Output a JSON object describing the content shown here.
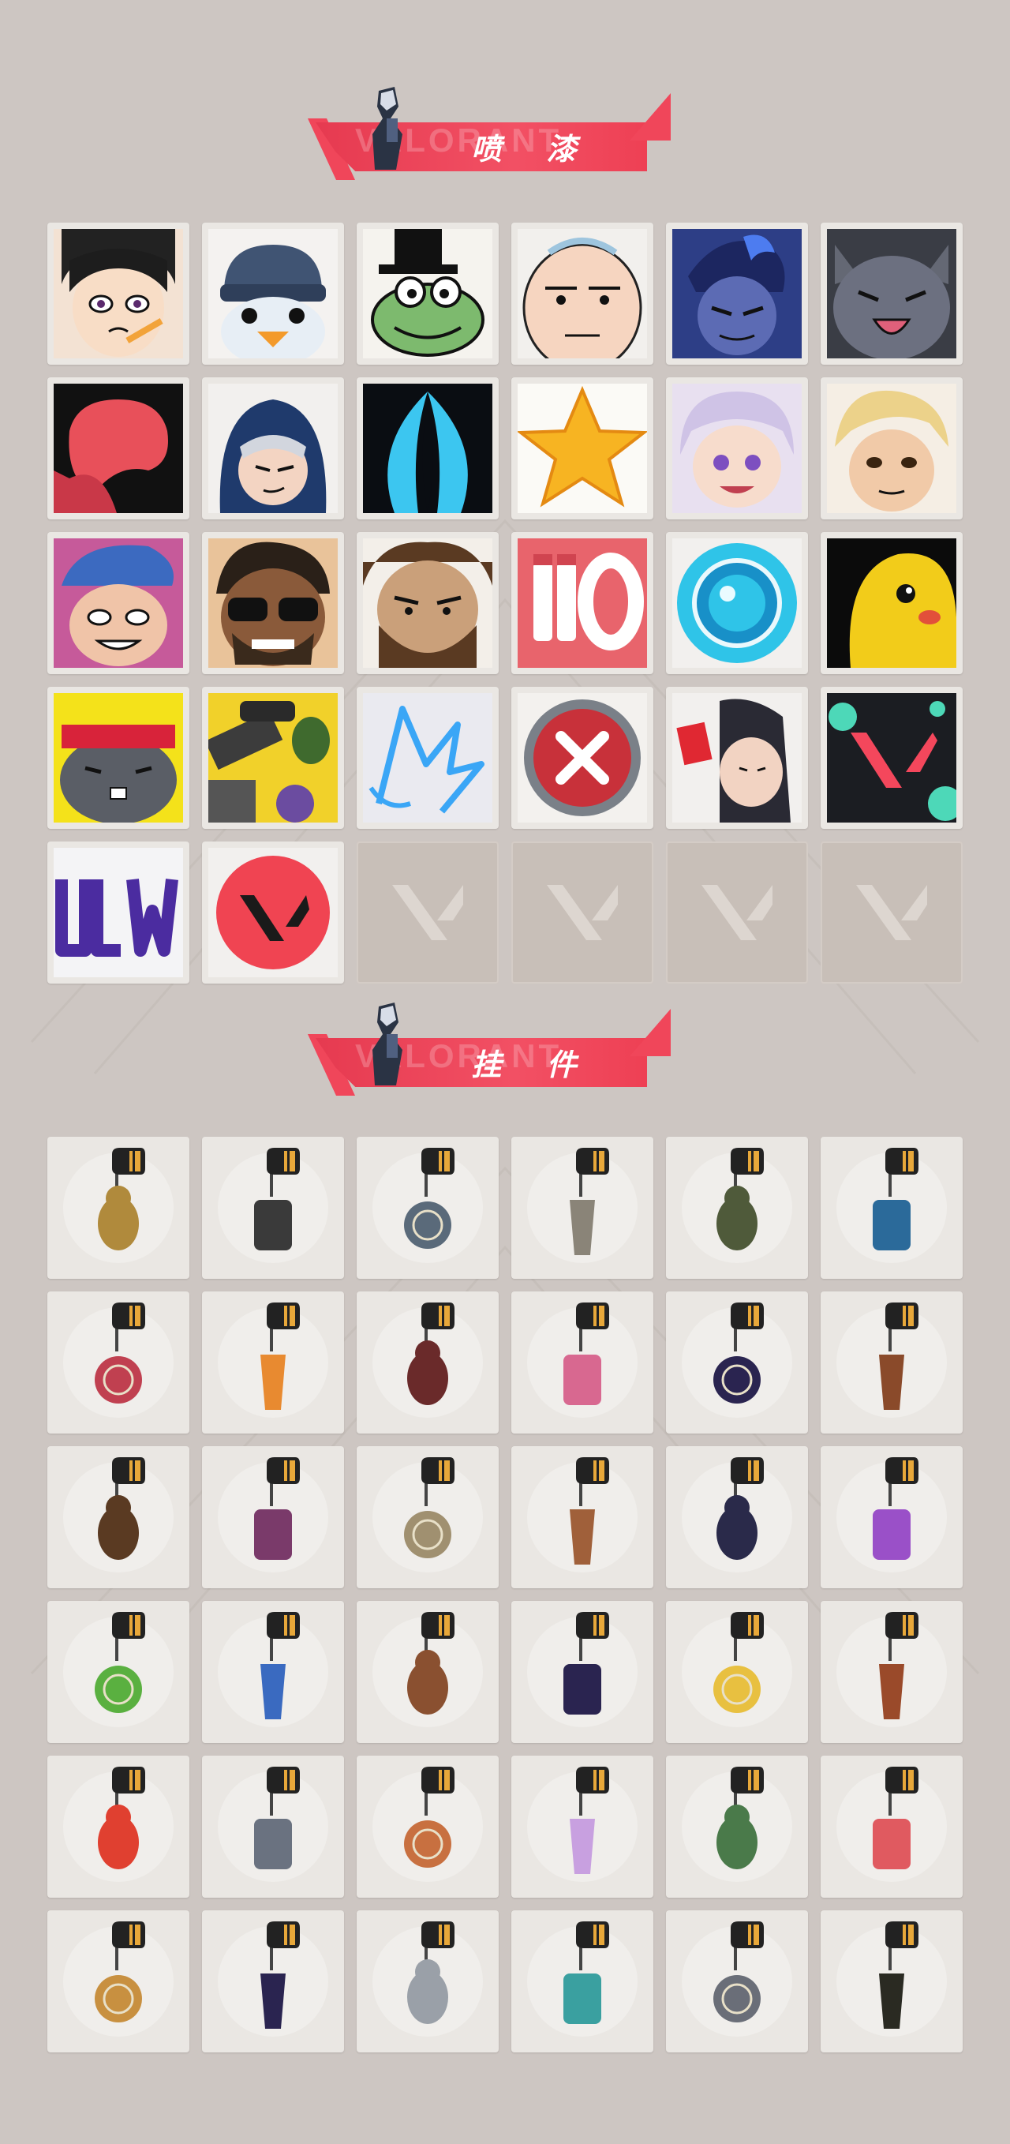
{
  "sections": [
    {
      "title": "喷 漆",
      "ghost_text": "VALORANT"
    },
    {
      "title": "挂 件",
      "ghost_text": "VALORANT"
    }
  ],
  "colors": {
    "accent": "#f0465a",
    "background": "#cdc6c2",
    "tile": "#eae7e3"
  },
  "sprays": [
    {
      "name": "spray-girl-pencil-icon"
    },
    {
      "name": "spray-penguin-beanie-icon"
    },
    {
      "name": "spray-frog-hat-icon"
    },
    {
      "name": "spray-bald-face-icon"
    },
    {
      "name": "spray-blue-agent-icon"
    },
    {
      "name": "spray-gray-cat-icon"
    },
    {
      "name": "spray-red-blob-icon"
    },
    {
      "name": "spray-hooded-agent-icon"
    },
    {
      "name": "spray-blue-flame-icon"
    },
    {
      "name": "spray-star-icon"
    },
    {
      "name": "spray-white-hair-girl-icon"
    },
    {
      "name": "spray-blond-agent-icon"
    },
    {
      "name": "spray-blue-cap-agent-icon"
    },
    {
      "name": "spray-sunglasses-agent-icon"
    },
    {
      "name": "spray-bearded-agent-icon"
    },
    {
      "name": "spray-ammo-counter-icon"
    },
    {
      "name": "spray-blue-orb-icon"
    },
    {
      "name": "spray-yellow-creature-icon"
    },
    {
      "name": "spray-bandana-cat-icon"
    },
    {
      "name": "spray-weapon-collage-icon"
    },
    {
      "name": "spray-neon-crown-icon"
    },
    {
      "name": "spray-red-x-button-icon"
    },
    {
      "name": "spray-red-card-agent-icon"
    },
    {
      "name": "spray-valorant-splash-icon"
    },
    {
      "name": "spray-purple-graffiti-icon"
    },
    {
      "name": "spray-valorant-red-circle-icon"
    }
  ],
  "empty_slots": 4,
  "buddies": [
    {
      "name": "buddy-gold-bear-icon"
    },
    {
      "name": "buddy-robot-drone-icon"
    },
    {
      "name": "buddy-blue-basket-icon"
    },
    {
      "name": "buddy-raccoon-icon"
    },
    {
      "name": "buddy-olive-pouch-icon"
    },
    {
      "name": "buddy-blue-can-icon"
    },
    {
      "name": "buddy-spiked-sword-icon"
    },
    {
      "name": "buddy-fire-fish-icon"
    },
    {
      "name": "buddy-rope-knot-icon"
    },
    {
      "name": "buddy-cupcake-icon"
    },
    {
      "name": "buddy-ep9-coin-icon"
    },
    {
      "name": "buddy-teddy-bell-icon"
    },
    {
      "name": "buddy-wood-gun-icon"
    },
    {
      "name": "buddy-agent-figure-icon"
    },
    {
      "name": "buddy-cowboy-figure-icon"
    },
    {
      "name": "buddy-leather-box-icon"
    },
    {
      "name": "buddy-ink-figure-icon"
    },
    {
      "name": "buddy-lava-lamp-icon"
    },
    {
      "name": "buddy-green-pager-icon"
    },
    {
      "name": "buddy-astronaut-icon"
    },
    {
      "name": "buddy-radio-icon"
    },
    {
      "name": "buddy-ep9-coin-2-icon"
    },
    {
      "name": "buddy-banana-icon"
    },
    {
      "name": "buddy-popsicle-icon"
    },
    {
      "name": "buddy-fruit-skewer-icon"
    },
    {
      "name": "buddy-agent-card-icon"
    },
    {
      "name": "buddy-hot-air-balloon-icon"
    },
    {
      "name": "buddy-crystal-girl-icon"
    },
    {
      "name": "buddy-robot-box-icon"
    },
    {
      "name": "buddy-watermelon-icon"
    },
    {
      "name": "buddy-honey-pot-icon"
    },
    {
      "name": "buddy-ep9-coin-3-icon"
    },
    {
      "name": "buddy-silver-hook-icon"
    },
    {
      "name": "buddy-ufo-icon"
    },
    {
      "name": "buddy-stone-cat-icon"
    },
    {
      "name": "buddy-valorant-coin-icon"
    }
  ]
}
